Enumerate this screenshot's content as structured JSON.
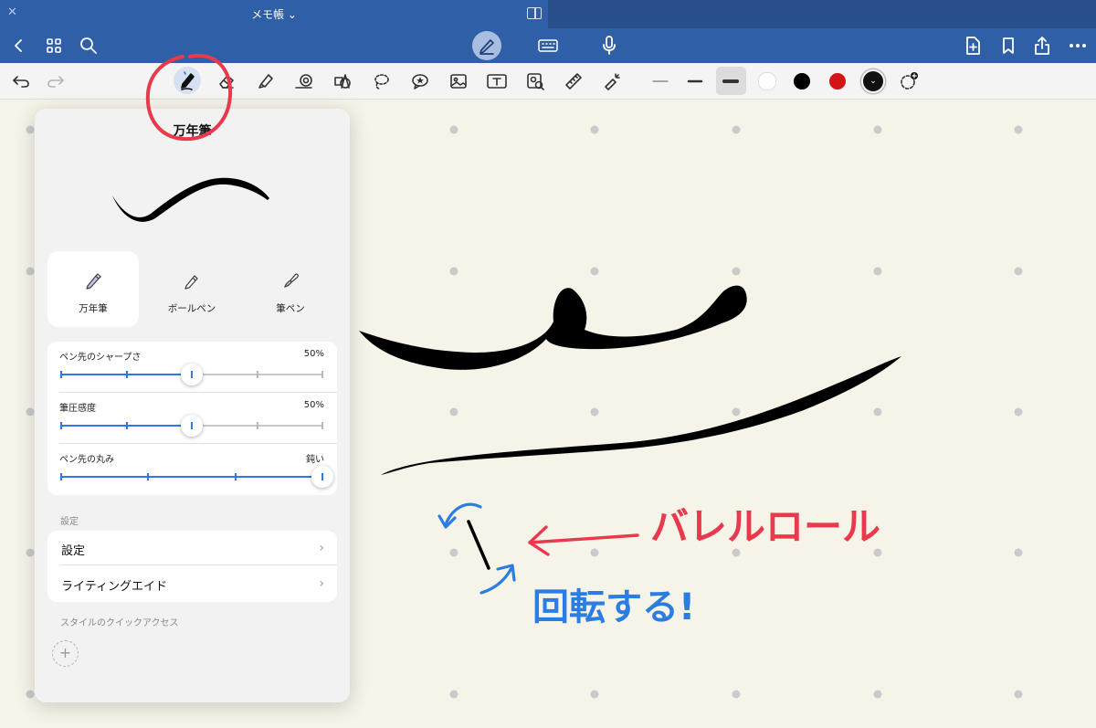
{
  "app": {
    "title": "メモ帳 ⌄"
  },
  "panel": {
    "title": "万年筆",
    "pen_types": [
      {
        "label": "万年筆",
        "selected": true
      },
      {
        "label": "ボールペン",
        "selected": false
      },
      {
        "label": "筆ペン",
        "selected": false
      }
    ],
    "sliders": [
      {
        "label": "ペン先のシャープさ",
        "value_text": "50%",
        "level": 0.5
      },
      {
        "label": "筆圧感度",
        "value_text": "50%",
        "level": 0.5
      },
      {
        "label": "ペン先の丸み",
        "value_text": "鈍い",
        "level": 1.0
      }
    ],
    "settings_section": "設定",
    "settings_items": [
      {
        "label": "設定",
        "chevron": "›"
      },
      {
        "label": "ライティングエイド",
        "chevron": "›"
      }
    ],
    "quick_access_section": "スタイルのクイックアクセス",
    "add_style": "+"
  },
  "toolbar": {
    "selected_tool": "fountain-pen",
    "colors": [
      "#ffffff",
      "#000000",
      "#d41414",
      "#111111"
    ],
    "selected_thickness": "thick"
  },
  "annotations": {
    "red_text": "バレルロール",
    "blue_text": "回転する!",
    "red_color": "#e8394d",
    "blue_color": "#2b7de1"
  },
  "colors": {
    "titlebar": "#2f5fa6",
    "accent": "#2d7be0",
    "paper": "#f6f4e8"
  }
}
